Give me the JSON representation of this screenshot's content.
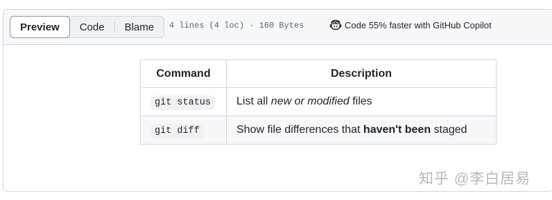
{
  "toolbar": {
    "tabs": [
      {
        "label": "Preview"
      },
      {
        "label": "Code"
      },
      {
        "label": "Blame"
      }
    ],
    "file_info": "4 lines (4 loc) · 160 Bytes",
    "copilot_label": "Code 55% faster with GitHub Copilot"
  },
  "table": {
    "headers": [
      "Command",
      "Description"
    ],
    "rows": [
      {
        "command": "git status",
        "desc_before": "List all ",
        "desc_em": "new or modified",
        "desc_after": " files"
      },
      {
        "command": "git diff",
        "desc_before": "Show file differences that ",
        "desc_strong": "haven't been",
        "desc_after": " staged"
      }
    ]
  },
  "watermark": "知乎 @李白居易",
  "icons": {
    "copilot": "copilot-icon"
  }
}
